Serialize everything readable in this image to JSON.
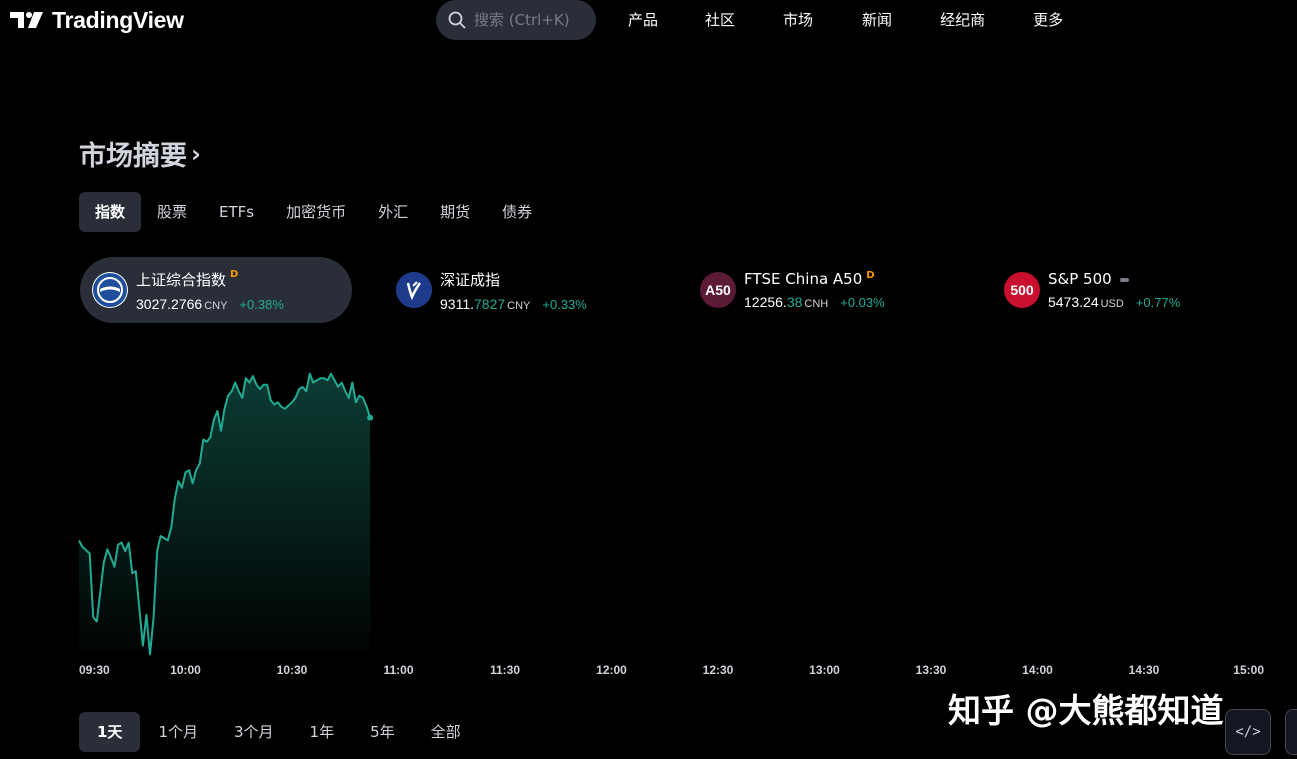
{
  "header": {
    "logo_text": "TradingView",
    "search_placeholder": "搜索 (Ctrl+K)",
    "nav": [
      "产品",
      "社区",
      "市场",
      "新闻",
      "经纪商",
      "更多"
    ]
  },
  "section": {
    "title": "市场摘要",
    "chevron": "›"
  },
  "tabs": [
    "指数",
    "股票",
    "ETFs",
    "加密货币",
    "外汇",
    "期货",
    "债券"
  ],
  "active_tab": 0,
  "cards": [
    {
      "name": "上证综合指数",
      "flag": "D",
      "icon": "sse-logo-icon",
      "icon_text": "",
      "icon_color": "#1e3a8a",
      "price_main": "3027.2766",
      "price_tail": "",
      "currency": "CNY",
      "change": "+0.38%",
      "active": true
    },
    {
      "name": "深证成指",
      "flag": "",
      "icon": "szse-logo-icon",
      "icon_text": "",
      "icon_color": "#1e3a8a",
      "price_main": "9311.",
      "price_tail": "7827",
      "currency": "CNY",
      "change": "+0.33%",
      "active": false
    },
    {
      "name": "FTSE China A50",
      "flag": "D",
      "icon": "a50-icon",
      "icon_text": "A50",
      "icon_color": "#5b1a35",
      "price_main": "12256.",
      "price_tail": "38",
      "currency": "CNH",
      "change": "+0.03%",
      "active": false
    },
    {
      "name": "S&P 500",
      "flag": "dash",
      "icon": "sp500-icon",
      "icon_text": "500",
      "icon_color": "#c8102e",
      "price_main": "5473.24",
      "price_tail": "",
      "currency": "USD",
      "change": "+0.77%",
      "active": false
    }
  ],
  "chart_data": {
    "type": "area",
    "x_ticks": [
      "09:30",
      "10:00",
      "10:30",
      "11:00",
      "11:30",
      "12:00",
      "12:30",
      "13:00",
      "13:30",
      "14:00",
      "14:30",
      "15:00"
    ],
    "x_unit_minutes_from_0930": [
      0,
      30,
      60,
      90,
      120,
      150,
      180,
      210,
      240,
      270,
      300,
      330
    ],
    "series": [
      {
        "color": "#22ab94",
        "x": [
          0,
          1,
          3,
          4,
          5,
          7,
          8,
          9,
          10,
          11,
          12,
          13,
          14,
          15,
          16,
          18,
          19,
          20,
          21,
          22,
          23,
          25,
          26,
          27,
          28,
          29,
          30,
          31,
          32,
          33,
          34,
          35,
          36,
          37,
          38,
          39,
          40,
          41,
          42,
          43,
          44,
          45,
          46,
          47,
          48,
          49,
          50,
          51,
          52,
          53,
          54,
          55,
          56,
          57,
          58,
          60,
          61,
          62,
          63,
          64,
          65,
          66,
          67,
          68,
          69,
          70,
          71,
          72,
          73,
          74,
          75,
          76,
          77,
          78,
          79,
          80,
          81,
          82
        ],
        "y": [
          3023.0,
          3022.7,
          3022.4,
          3019.5,
          3019.3,
          3022.0,
          3022.6,
          3022.2,
          3021.8,
          3022.8,
          3022.9,
          3022.5,
          3022.9,
          3021.5,
          3021.6,
          3018.2,
          3019.6,
          3017.8,
          3019.5,
          3022.5,
          3023.2,
          3023.0,
          3023.6,
          3024.9,
          3025.7,
          3025.4,
          3026.1,
          3026.2,
          3025.6,
          3026.2,
          3026.5,
          3027.6,
          3027.5,
          3027.7,
          3028.5,
          3028.9,
          3028.0,
          3029.0,
          3029.6,
          3029.8,
          3030.2,
          3029.8,
          3029.5,
          3030.4,
          3030.2,
          3030.5,
          3030.1,
          3029.9,
          3030.1,
          3030.1,
          3029.4,
          3029.2,
          3029.3,
          3029.1,
          3029.0,
          3029.3,
          3029.5,
          3029.9,
          3030.0,
          3029.8,
          3030.6,
          3030.2,
          3030.3,
          3030.4,
          3030.4,
          3030.3,
          3030.6,
          3030.3,
          3030.0,
          3030.2,
          3029.8,
          3029.5,
          3030.2,
          3029.3,
          3029.6,
          3029.5,
          3029.1,
          3028.6
        ],
        "last_point": true
      }
    ]
  },
  "ranges": [
    "1天",
    "1个月",
    "3个月",
    "1年",
    "5年",
    "全部"
  ],
  "active_range": 0,
  "watermark": "知乎 @大熊都知道",
  "embed_label": "</>"
}
